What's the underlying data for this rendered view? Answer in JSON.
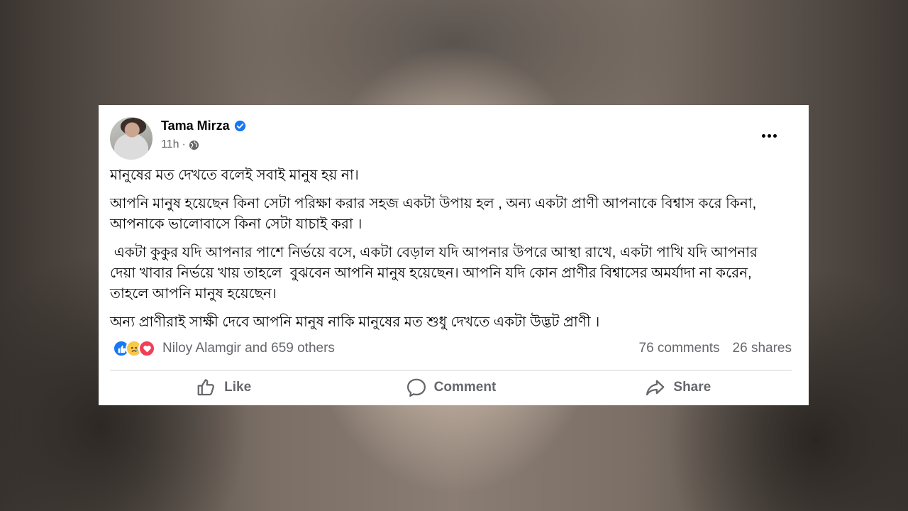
{
  "post": {
    "author": "Tama Mirza",
    "time": "11h",
    "separator": "·",
    "paragraphs": [
      "মানুষের মত দেখতে বলেই সবাই মানুষ হয় না।",
      "আপনি মানুষ হয়েছেন কিনা সেটা পরিক্ষা করার সহজ একটা উপায় হল , অন্য একটা প্রাণী আপনাকে বিশ্বাস করে কিনা, আপনাকে ভালোবাসে কিনা সেটা যাচাই করা ।",
      " একটা কুকুর যদি আপনার পাশে নির্ভয়ে বসে, একটা বেড়াল যদি আপনার উপরে আস্থা রাখে, একটা পাখি যদি আপনার দেয়া খাবার নির্ভয়ে খায় তাহলে  বুঝবেন আপনি মানুষ হয়েছেন। আপনি যদি কোন প্রাণীর বিশ্বাসের অমর্যাদা না করেন,  তাহলে আপনি মানুষ হয়েছেন।",
      "অন্য প্রাণীরাই সাক্ষী দেবে আপনি মানুষ নাকি মানুষের মত শুধু দেখতে একটা উদ্ভট প্রাণী ।"
    ],
    "reactions_text": "Niloy Alamgir and 659 others",
    "comments": "76 comments",
    "shares": "26 shares",
    "actions": {
      "like": "Like",
      "comment": "Comment",
      "share": "Share"
    },
    "icons": {
      "verified": "verified-badge-icon",
      "audience": "globe-icon",
      "more": "more-options-icon",
      "reactions": [
        "like-reaction-icon",
        "sad-reaction-icon",
        "love-reaction-icon"
      ]
    },
    "colors": {
      "verified": "#1877f2",
      "text": "#050505",
      "secondary": "#65676b",
      "like": "#1877f2",
      "sad": "#f7c84a",
      "love": "#f33e58"
    }
  }
}
